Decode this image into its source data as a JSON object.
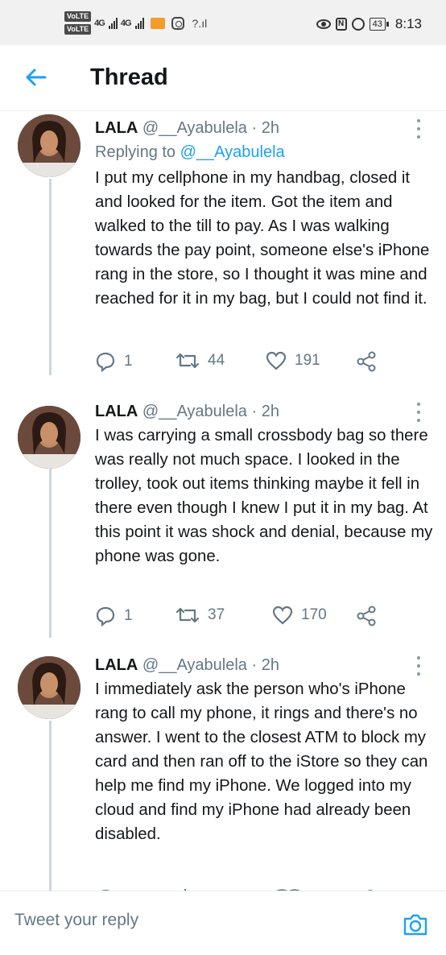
{
  "status_bar": {
    "volte_top": "VoLTE",
    "volte_bottom": "VoLTE",
    "net1": "4G",
    "net2": "4G",
    "battery": "43",
    "time": "8:13"
  },
  "header": {
    "title": "Thread"
  },
  "tweets": [
    {
      "name": "LALA",
      "handle": "@__Ayabulela",
      "time": "· 2h",
      "reply_prefix": "Replying to ",
      "reply_handle": "@__Ayabulela",
      "text": "I put my cellphone in my handbag, closed it and looked for the item. Got the item and walked to the till to pay. As I was walking towards the pay point, someone else's iPhone rang in the store, so I thought it was mine and reached for it in my bag, but I could not find it.",
      "replies": "1",
      "retweets": "44",
      "likes": "191"
    },
    {
      "name": "LALA",
      "handle": "@__Ayabulela",
      "time": "· 2h",
      "text": "I was carrying a small crossbody bag so there was really not much space. I looked in the trolley, took out items thinking maybe it fell in there even though I knew I put it in my bag. At this point it was shock and denial, because my phone was gone.",
      "replies": "1",
      "retweets": "37",
      "likes": "170"
    },
    {
      "name": "LALA",
      "handle": "@__Ayabulela",
      "time": "· 2h",
      "text": "I immediately ask the person who's iPhone rang to call my phone, it rings and there's no answer. I went to the closest ATM to block my card and then ran off to the iStore so they can help me find my iPhone. We logged into my cloud and find my iPhone had already been disabled."
    }
  ],
  "reply_bar": {
    "placeholder": "Tweet your reply"
  },
  "colors": {
    "accent": "#1da1f2",
    "muted": "#657786",
    "text": "#14171a",
    "divider": "#e6ecf0"
  },
  "icons": [
    "back-arrow-icon",
    "more-icon",
    "reply-icon",
    "retweet-icon",
    "like-icon",
    "share-icon",
    "camera-icon",
    "avatar"
  ]
}
